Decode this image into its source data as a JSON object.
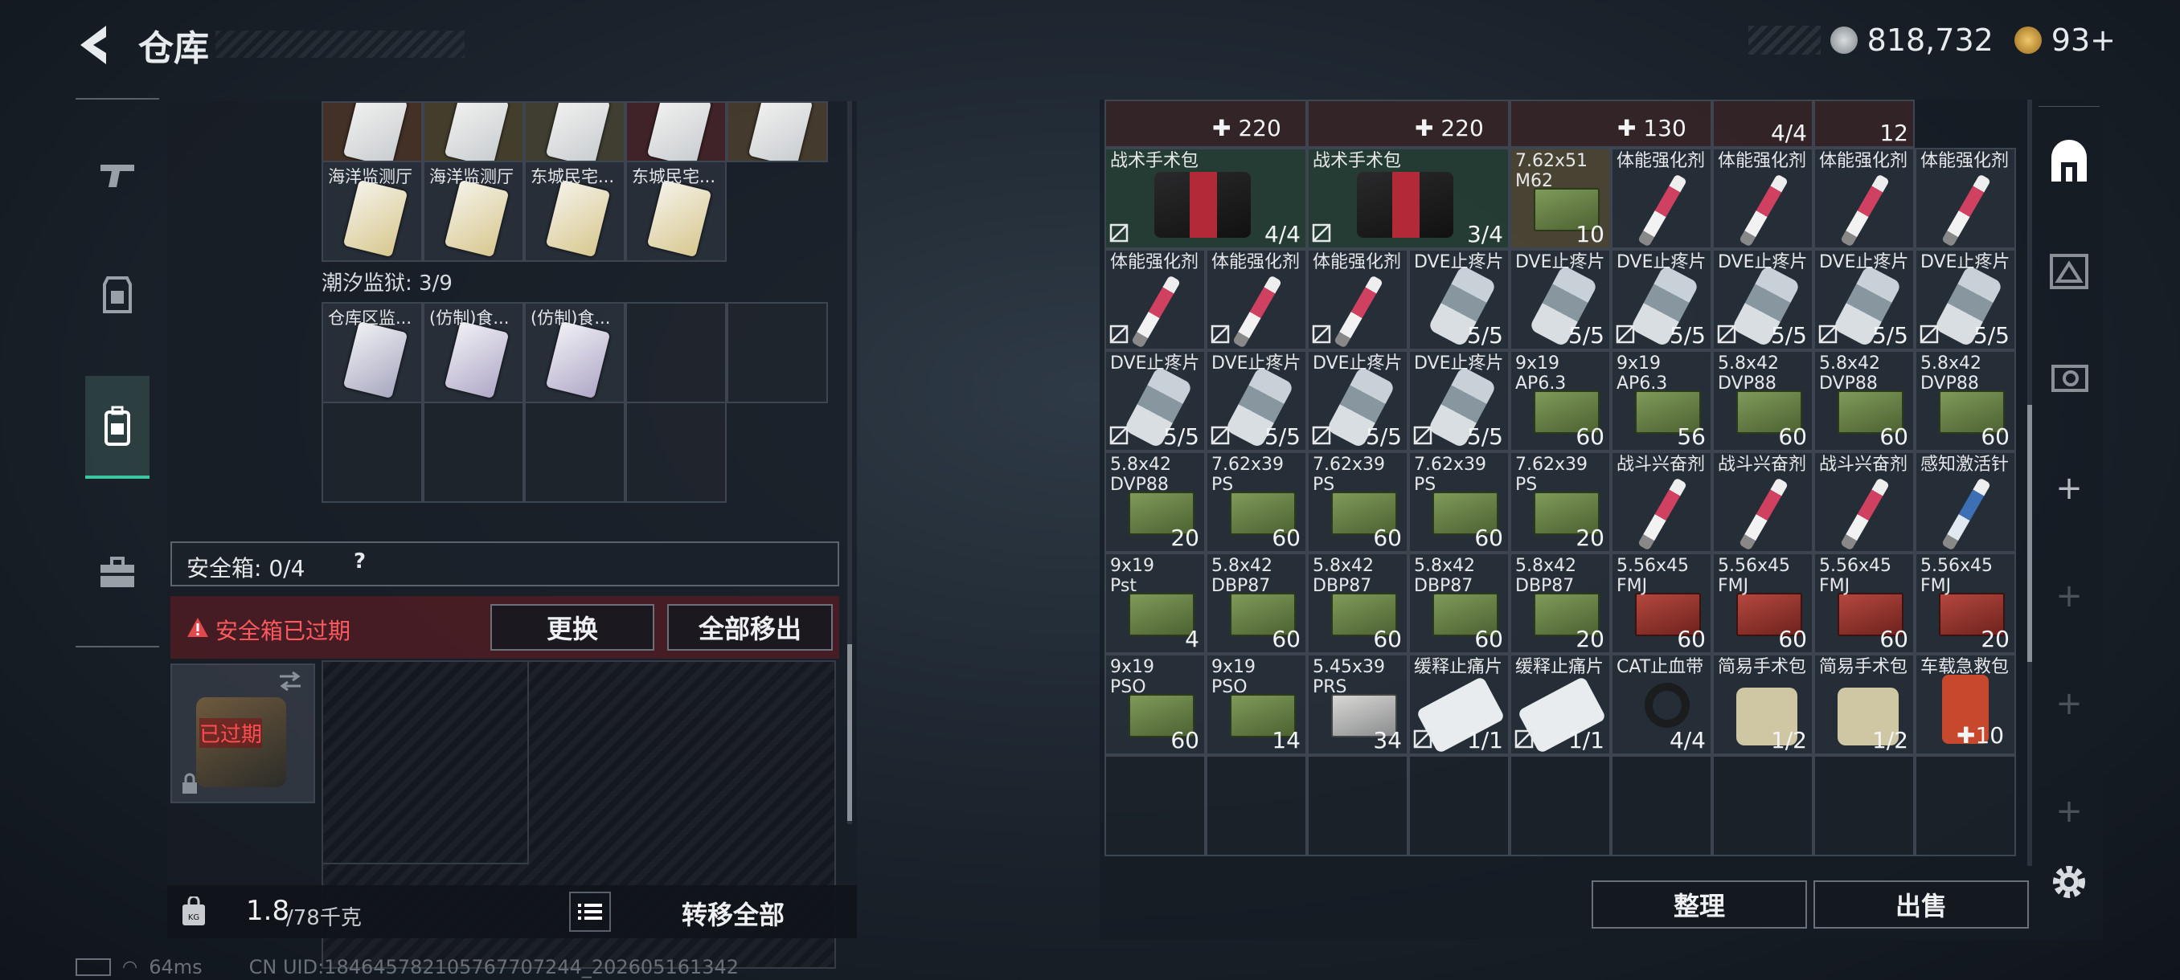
{
  "header": {
    "title": "仓库",
    "currency": "818,732",
    "premium": "93+"
  },
  "left_panel": {
    "row1_labels": [
      "海洋监测厅",
      "海洋监测厅",
      "东城民宅...",
      "东城民宅..."
    ],
    "section_title": "潮汐监狱: 3/9",
    "row2_labels": [
      "仓库区监...",
      "(仿制)食...",
      "(仿制)食..."
    ],
    "safebox_label": "安全箱: 0/4",
    "help": "?",
    "expired_notice": "安全箱已过期",
    "replace_btn": "更换",
    "move_all_out_btn": "全部移出",
    "expired_badge": "已过期",
    "weight_value": "1.8",
    "weight_max": "/78千克",
    "transfer_all_btn": "转移全部"
  },
  "status": {
    "ping": "64ms",
    "uid": "CN UID:18464578210576770724​4_202605161342"
  },
  "right_panel": {
    "top_row": [
      {
        "plus": "220"
      },
      {
        "plus": "220"
      },
      {
        "plus": "130"
      },
      {
        "count": "4/4"
      },
      {
        "count": "12"
      }
    ],
    "items": [
      {
        "label": "战术手术包",
        "count": "4/4",
        "icon": "bag",
        "noins": true,
        "span": 2
      },
      {
        "label": "战术手术包",
        "count": "3/4",
        "icon": "bag",
        "noins": true,
        "span": 2
      },
      {
        "label": "7.62x51\nM62",
        "count": "10",
        "icon": "ammo-g"
      },
      {
        "label": "体能强化剂",
        "icon": "syringe"
      },
      {
        "label": "体能强化剂",
        "icon": "syringe"
      },
      {
        "label": "体能强化剂",
        "icon": "syringe"
      },
      {
        "label": "体能强化剂",
        "icon": "syringe"
      },
      {
        "label": "体能强化剂",
        "icon": "syringe",
        "noins": true
      },
      {
        "label": "体能强化剂",
        "icon": "syringe",
        "noins": true
      },
      {
        "label": "体能强化剂",
        "icon": "syringe",
        "noins": true
      },
      {
        "label": "DVE止疼片",
        "count": "5/5",
        "icon": "pill"
      },
      {
        "label": "DVE止疼片",
        "count": "5/5",
        "icon": "pill"
      },
      {
        "label": "DVE止疼片",
        "count": "5/5",
        "icon": "pill",
        "noins": true
      },
      {
        "label": "DVE止疼片",
        "count": "5/5",
        "icon": "pill",
        "noins": true
      },
      {
        "label": "DVE止疼片",
        "count": "5/5",
        "icon": "pill",
        "noins": true
      },
      {
        "label": "DVE止疼片",
        "count": "5/5",
        "icon": "pill",
        "noins": true
      },
      {
        "label": "DVE止疼片",
        "count": "5/5",
        "icon": "pill",
        "noins": true
      },
      {
        "label": "DVE止疼片",
        "count": "5/5",
        "icon": "pill",
        "noins": true
      },
      {
        "label": "DVE止疼片",
        "count": "5/5",
        "icon": "pill",
        "noins": true
      },
      {
        "label": "DVE止疼片",
        "count": "5/5",
        "icon": "pill",
        "noins": true
      },
      {
        "label": "9x19\nAP6.3",
        "count": "60",
        "icon": "ammo-g"
      },
      {
        "label": "9x19\nAP6.3",
        "count": "56",
        "icon": "ammo-g"
      },
      {
        "label": "5.8x42\nDVP88",
        "count": "60",
        "icon": "ammo-g"
      },
      {
        "label": "5.8x42\nDVP88",
        "count": "60",
        "icon": "ammo-g"
      },
      {
        "label": "5.8x42\nDVP88",
        "count": "60",
        "icon": "ammo-g"
      },
      {
        "label": "5.8x42\nDVP88",
        "count": "20",
        "icon": "ammo-g"
      },
      {
        "label": "7.62x39\nPS",
        "count": "60",
        "icon": "ammo-g"
      },
      {
        "label": "7.62x39\nPS",
        "count": "60",
        "icon": "ammo-g"
      },
      {
        "label": "7.62x39\nPS",
        "count": "60",
        "icon": "ammo-g"
      },
      {
        "label": "7.62x39\nPS",
        "count": "20",
        "icon": "ammo-g"
      },
      {
        "label": "战斗兴奋剂",
        "icon": "syringe"
      },
      {
        "label": "战斗兴奋剂",
        "icon": "syringe"
      },
      {
        "label": "战斗兴奋剂",
        "icon": "syringe"
      },
      {
        "label": "感知激活针",
        "icon": "syringe-b"
      },
      {
        "label": "9x19\nPst",
        "count": "4",
        "icon": "ammo-g"
      },
      {
        "label": "5.8x42\nDBP87",
        "count": "60",
        "icon": "ammo-g"
      },
      {
        "label": "5.8x42\nDBP87",
        "count": "60",
        "icon": "ammo-g"
      },
      {
        "label": "5.8x42\nDBP87",
        "count": "60",
        "icon": "ammo-g"
      },
      {
        "label": "5.8x42\nDBP87",
        "count": "20",
        "icon": "ammo-g"
      },
      {
        "label": "5.56x45\nFMJ",
        "count": "60",
        "icon": "ammo-r"
      },
      {
        "label": "5.56x45\nFMJ",
        "count": "60",
        "icon": "ammo-r"
      },
      {
        "label": "5.56x45\nFMJ",
        "count": "60",
        "icon": "ammo-r"
      },
      {
        "label": "5.56x45\nFMJ",
        "count": "20",
        "icon": "ammo-r"
      },
      {
        "label": "9x19\nPSO",
        "count": "60",
        "icon": "ammo-g"
      },
      {
        "label": "9x19\nPSO",
        "count": "14",
        "icon": "ammo-g"
      },
      {
        "label": "5.45x39\nPRS",
        "count": "34",
        "icon": "ammo-w"
      },
      {
        "label": "缓释止痛片",
        "count": "1/1",
        "icon": "sheet",
        "noins": true
      },
      {
        "label": "缓释止痛片",
        "count": "1/1",
        "icon": "sheet",
        "noins": true
      },
      {
        "label": "CAT止血带",
        "count": "4/4",
        "icon": "tq"
      },
      {
        "label": "简易手术包",
        "count": "1/2",
        "icon": "pouch"
      },
      {
        "label": "简易手术包",
        "count": "1/2",
        "icon": "pouch"
      },
      {
        "label": "车载急救包",
        "plus": "10",
        "icon": "fak"
      }
    ],
    "sort_btn": "整理",
    "sell_btn": "出售"
  }
}
